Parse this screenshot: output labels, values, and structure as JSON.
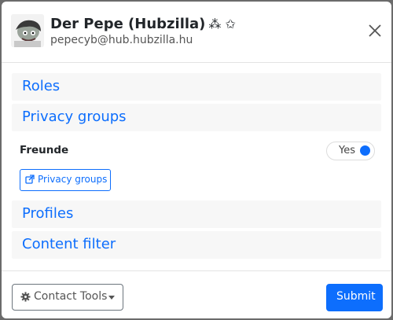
{
  "header": {
    "contact_name": "Der Pepe (Hubzilla)",
    "name_marks": "⁂ ✩",
    "contact_address": "pepecyb@hub.hubzilla.hu"
  },
  "sections": {
    "roles": "Roles",
    "privacy_groups": "Privacy groups",
    "profiles": "Profiles",
    "content_filter": "Content filter"
  },
  "privacy_groups": {
    "group_name": "Freunde",
    "toggle_value": "Yes",
    "toggle_checked": true,
    "manage_button_label": "Privacy groups"
  },
  "footer": {
    "contact_tools_label": "Contact Tools",
    "submit_label": "Submit"
  },
  "colors": {
    "accent": "#0d6efd"
  }
}
